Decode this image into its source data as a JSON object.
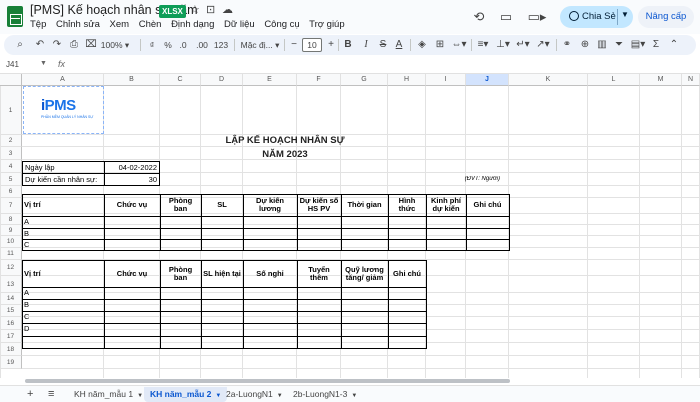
{
  "app": {
    "doc_title": "[PMS] Kế hoạch nhân sự năm",
    "file_badge": "XLSX",
    "menu": [
      "Tệp",
      "Chỉnh sửa",
      "Xem",
      "Chèn",
      "Định dạng",
      "Dữ liệu",
      "Công cụ",
      "Trợ giúp"
    ],
    "share_label": "Chia Sẻ",
    "upgrade_label": "Nâng cấp"
  },
  "toolbar": {
    "zoom": "100%",
    "currency": "₫",
    "percent": "%",
    "dec_less": ".0",
    "dec_more": ".00",
    "num_format": "123",
    "font": "Mặc đị...",
    "font_size": "10",
    "bold": "B",
    "italic": "I",
    "strike": "S",
    "text_color": "A"
  },
  "formula_bar": {
    "cell_ref": "J41",
    "fx": "fx"
  },
  "columns": [
    "A",
    "B",
    "C",
    "D",
    "E",
    "F",
    "G",
    "H",
    "I",
    "J",
    "K",
    "L",
    "M",
    "N",
    "O"
  ],
  "selected_column": "J",
  "rows": [
    "1",
    "2",
    "3",
    "4",
    "5",
    "6",
    "7",
    "8",
    "9",
    "10",
    "11",
    "12",
    "13",
    "14",
    "15",
    "16",
    "17",
    "18",
    "19"
  ],
  "logo": {
    "brand": "PMS",
    "tagline": "PHẦN MỀM QUẢN LÝ NHÂN SỰ"
  },
  "sheet": {
    "title": "LẬP KẾ HOẠCH NHÂN SỰ",
    "year": "NĂM 2023",
    "date_label": "Ngày lập",
    "date_value": "04-02-2022",
    "forecast_label": "Dự kiến cần nhân sự:",
    "forecast_value": "30",
    "unit_note": "(ĐVT: Người)",
    "table1": {
      "headers": [
        "Vị trí",
        "Chức vụ",
        "Phòng ban",
        "SL",
        "Dự kiến lương",
        "Dự kiến số HS PV",
        "Thời gian",
        "Hình thức",
        "Kinh phí dự kiến",
        "Ghi chú"
      ],
      "rows": [
        "A",
        "B",
        "C"
      ]
    },
    "table2": {
      "headers": [
        "Vị trí",
        "Chức vụ",
        "Phòng ban",
        "SL hiện tại",
        "Số nghỉ",
        "Tuyển thêm",
        "Quỹ lương tăng/ giảm",
        "Ghi chú"
      ],
      "rows": [
        "A",
        "B",
        "C",
        "D",
        "",
        ""
      ]
    }
  },
  "tabs": [
    {
      "label": "KH năm_mẫu 1",
      "active": false
    },
    {
      "label": "KH năm_mẫu 2",
      "active": true
    },
    {
      "label": "2a-LuongN1",
      "active": false
    },
    {
      "label": "2b-LuongN1-3",
      "active": false
    }
  ]
}
